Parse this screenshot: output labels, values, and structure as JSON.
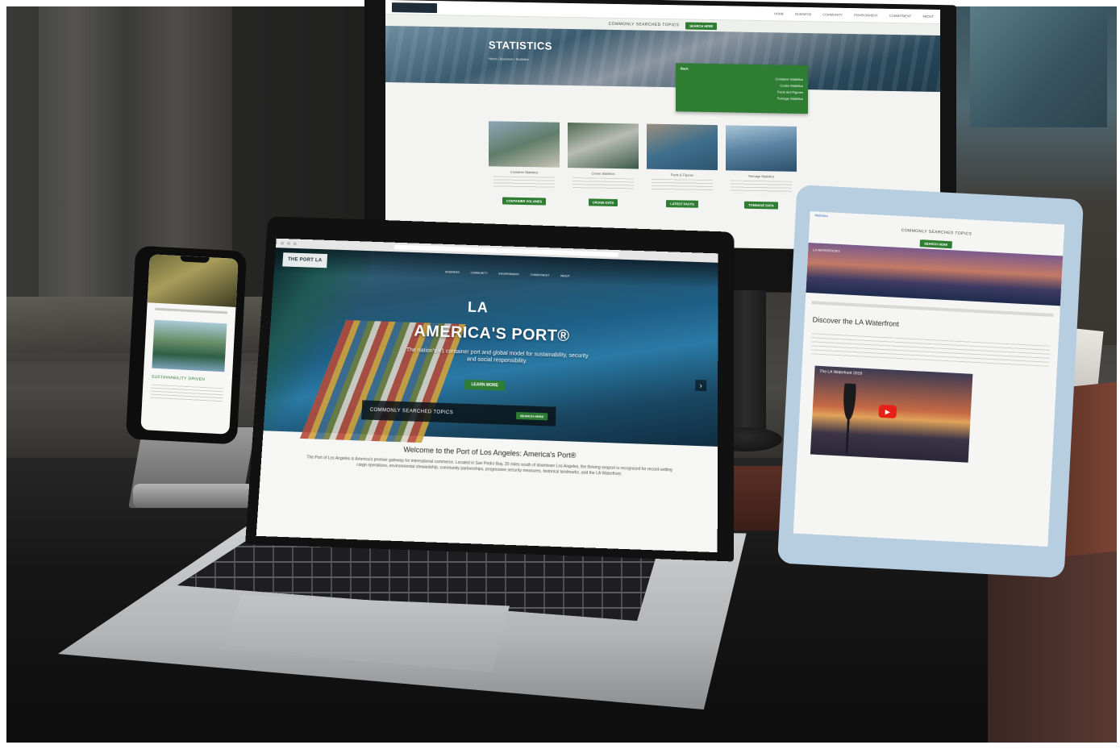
{
  "monitor": {
    "nav_links": [
      "Home",
      "Business",
      "Community",
      "Environment",
      "Commitment",
      "About"
    ],
    "search_prompt": "COMMONLY SEARCHED TOPICS",
    "search_button": "SEARCH HERE",
    "hero_title": "STATISTICS",
    "breadcrumb": "Home / Business / Statistics",
    "dropdown": {
      "back": "Back",
      "items": [
        "Container Statistics",
        "Cruise Statistics",
        "Facts and Figures",
        "Tonnage Statistics"
      ]
    },
    "cards": [
      {
        "title": "Container Statistics",
        "button": "CONTAINER VOLUMES"
      },
      {
        "title": "Cruise Statistics",
        "button": "CRUISE DATA"
      },
      {
        "title": "Facts & Figures",
        "button": "LATEST FACTS"
      },
      {
        "title": "Tonnage Statistics",
        "button": "TONNAGE DATA"
      }
    ]
  },
  "laptop": {
    "menu": [
      "Business",
      "Community",
      "Environment",
      "Commitment",
      "About"
    ],
    "logo": "THE PORT LA",
    "la_mark": "LA",
    "hero_title": "AMERICA'S PORT®",
    "hero_subtitle": "The nation's #1 container port and global model for sustainability, security and social responsibility.",
    "learn_more": "LEARN MORE",
    "topics_label": "COMMONLY SEARCHED TOPICS",
    "topics_button": "SEARCH HERE",
    "next_arrow": "›",
    "welcome_title": "Welcome to the Port of Los Angeles: America's Port®",
    "welcome_text": "The Port of Los Angeles is America's premier gateway for international commerce. Located in San Pedro Bay, 20 miles south of downtown Los Angeles, the thriving seaport is recognized for record-setting cargo operations, environmental stewardship, community partnerships, progressive security measures, historical landmarks, and the LA Waterfront."
  },
  "phone": {
    "section_title": "SUSTAINABILITY DRIVEN"
  },
  "tablet": {
    "status_left": "Websites",
    "search_prompt": "COMMONLY SEARCHED TOPICS",
    "search_button": "SEARCH HERE",
    "hero_label": "LA WATERFRONT",
    "heading": "Discover the LA Waterfront",
    "video_title": "The LA Waterfront 2019",
    "play_icon": "▶"
  },
  "colors": {
    "accent_green": "#2e7d32",
    "desk": "#161616"
  }
}
